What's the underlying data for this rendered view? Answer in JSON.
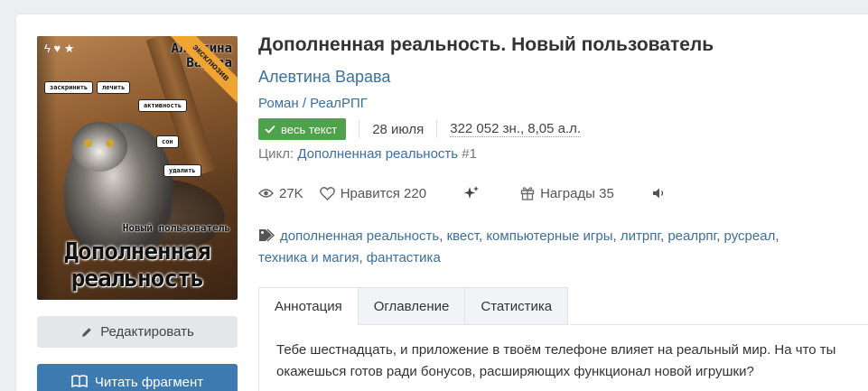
{
  "book": {
    "title": "Дополненная реальность. Новый пользователь",
    "author": "Алевтина Варава",
    "genre1": "Роман",
    "genre_sep": "/",
    "genre2": "РеалРПГ",
    "badge": "весь текст",
    "date": "28 июля",
    "size": "322 052 зн., 8,05 а.л.",
    "cycle_label": "Цикл:",
    "cycle_name": "Дополненная реальность",
    "cycle_num": "#1"
  },
  "cover": {
    "author_line1": "Алевтина",
    "author_line2": "Варава",
    "ribbon": "эксклюзив",
    "tags": [
      "заскринить",
      "лечить",
      "активность",
      "сон",
      "удалить"
    ],
    "subtitle": "Новый пользователь",
    "title_line1": "Дополненная",
    "title_line2": "реальность"
  },
  "stats": {
    "views": "27K",
    "likes": "Нравится 220",
    "awards": "Награды 35"
  },
  "tags_list": [
    "дополненная реальность",
    "квест",
    "компьютерные игры",
    "литрпг",
    "реалрпг",
    "русреал",
    "техника и магия",
    "фантастика"
  ],
  "buttons": {
    "edit": "Редактировать",
    "read": "Читать фрагмент"
  },
  "tabs": [
    "Аннотация",
    "Оглавление",
    "Статистика"
  ],
  "annotation": "Тебе шестнадцать, и приложение в твоём телефоне влияет на реальный мир. На что ты окажешься готов ради бонусов, расширяющих функционал новой игрушки?",
  "colors": {
    "link": "#3a6fa0",
    "badge": "#4ea24a",
    "read_button": "#3d7aaf",
    "ribbon": "#f0a431"
  }
}
